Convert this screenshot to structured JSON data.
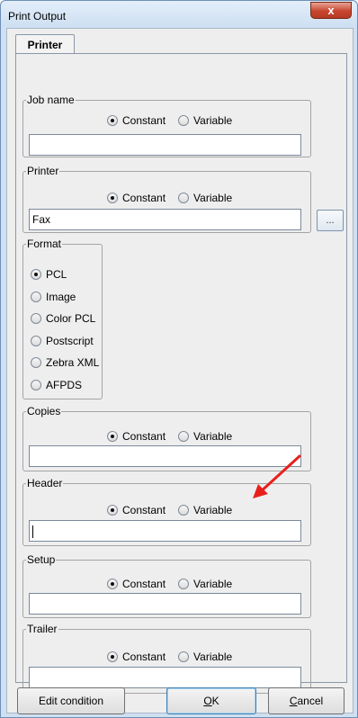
{
  "window": {
    "title": "Print Output",
    "close_label": "x"
  },
  "tabs": [
    {
      "label": "Printer"
    }
  ],
  "job_name": {
    "legend": "Job name",
    "option_constant": "Constant",
    "option_variable": "Variable",
    "value": ""
  },
  "printer": {
    "legend": "Printer",
    "option_constant": "Constant",
    "option_variable": "Variable",
    "value": "Fax",
    "browse_label": "..."
  },
  "format": {
    "legend": "Format",
    "options": [
      {
        "label": "PCL",
        "selected": true
      },
      {
        "label": "Image",
        "selected": false
      },
      {
        "label": "Color PCL",
        "selected": false
      },
      {
        "label": "Postscript",
        "selected": false
      },
      {
        "label": "Zebra XML",
        "selected": false
      },
      {
        "label": "AFPDS",
        "selected": false
      }
    ]
  },
  "copies": {
    "legend": "Copies",
    "option_constant": "Constant",
    "option_variable": "Variable",
    "value": ""
  },
  "header": {
    "legend": "Header",
    "option_constant": "Constant",
    "option_variable": "Variable",
    "value": ""
  },
  "setup": {
    "legend": "Setup",
    "option_constant": "Constant",
    "option_variable": "Variable",
    "value": ""
  },
  "trailer": {
    "legend": "Trailer",
    "option_constant": "Constant",
    "option_variable": "Variable",
    "value": ""
  },
  "buttons": {
    "edit_condition": "Edit condition",
    "ok_mnemonic": "O",
    "ok_rest": "K",
    "cancel_mnemonic": "C",
    "cancel_rest": "ancel"
  },
  "colors": {
    "annotation_arrow": "#e8201c",
    "title_bar": "#cddff2",
    "close_button": "#c7462f"
  },
  "icons": {
    "close": "close-x-icon",
    "annotation": "red-arrow-icon"
  }
}
